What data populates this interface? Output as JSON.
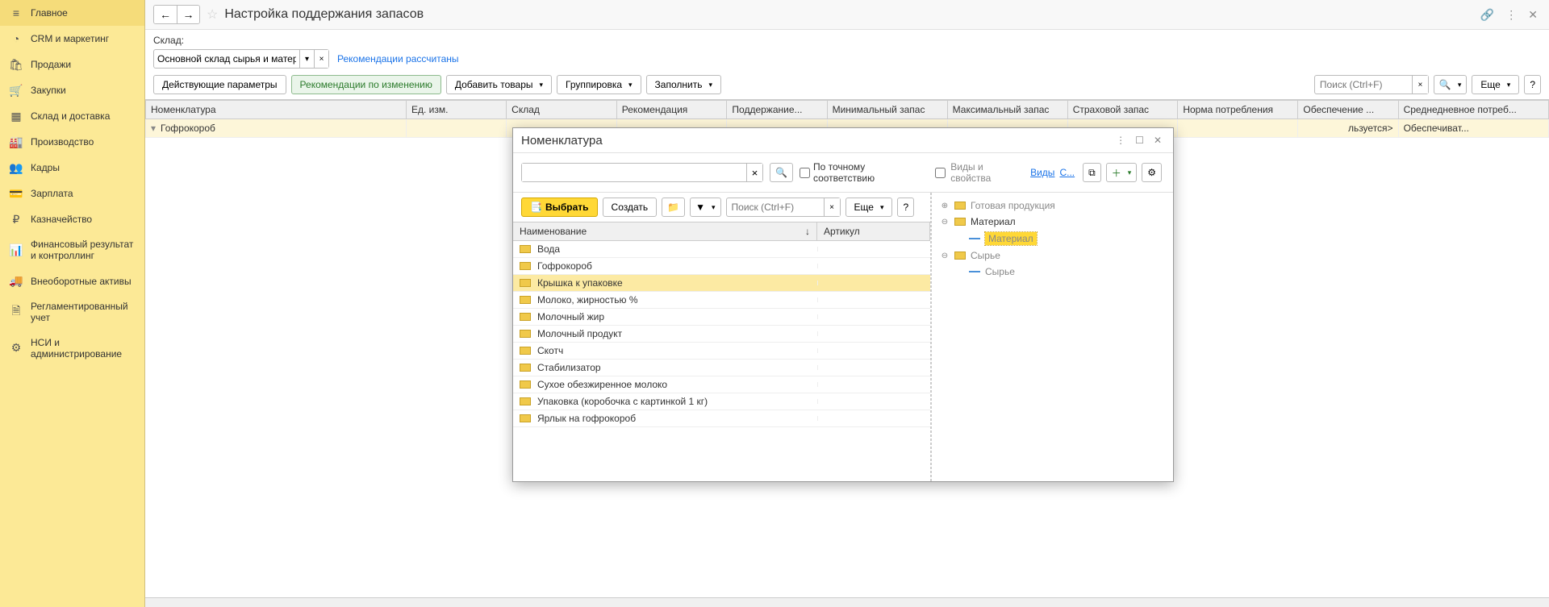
{
  "sidebar": {
    "items": [
      {
        "label": "Главное"
      },
      {
        "label": "CRM и маркетинг"
      },
      {
        "label": "Продажи"
      },
      {
        "label": "Закупки"
      },
      {
        "label": "Склад и доставка"
      },
      {
        "label": "Производство"
      },
      {
        "label": "Кадры"
      },
      {
        "label": "Зарплата"
      },
      {
        "label": "Казначейство"
      },
      {
        "label": "Финансовый результат и контроллинг"
      },
      {
        "label": "Внеоборотные активы"
      },
      {
        "label": "Регламентированный учет"
      },
      {
        "label": "НСИ и администрирование"
      }
    ]
  },
  "header": {
    "title": "Настройка поддержания запасов"
  },
  "warehouse": {
    "label": "Склад:",
    "value": "Основной склад сырья и материалов",
    "reco_link": "Рекомендации рассчитаны"
  },
  "toolbar": {
    "active_params": "Действующие параметры",
    "reco_changes": "Рекомендации по изменению",
    "add_goods": "Добавить товары",
    "grouping": "Группировка",
    "fill": "Заполнить",
    "more": "Еще",
    "search_placeholder": "Поиск (Ctrl+F)"
  },
  "columns": [
    "Номенклатура",
    "Ед. изм.",
    "Склад",
    "Рекомендация",
    "Поддержание...",
    "Минимальный запас",
    "Максимальный запас",
    "Страховой запас",
    "Норма потребления",
    "Обеспечение ...",
    "Среднедневное потреб..."
  ],
  "row": {
    "nomenclature": "Гофрокороб",
    "obespech": "Обеспечиват...",
    "used": "льзуется>"
  },
  "modal": {
    "title": "Номенклатура",
    "exact": "По точному соответствию",
    "types_label": "Виды и свойства",
    "types_link": "Виды",
    "types_c": "С...",
    "select": "Выбрать",
    "create": "Создать",
    "more": "Еще",
    "search_placeholder": "Поиск (Ctrl+F)",
    "col_name": "Наименование",
    "col_sort": "↓",
    "col_art": "Артикул",
    "items": [
      "Вода",
      "Гофрокороб",
      "Крышка к упаковке",
      "Молоко, жирностью %",
      "Молочный жир",
      "Молочный продукт",
      "Скотч",
      "Стабилизатор",
      "Сухое обезжиренное молоко",
      "Упаковка (коробочка с картинкой 1 кг)",
      "Ярлык на гофрокороб"
    ],
    "selected_index": 2,
    "tree": {
      "t0": "Готовая продукция",
      "t1": "Материал",
      "t1a": "Материал",
      "t2": "Сырье",
      "t2a": "Сырье"
    }
  }
}
